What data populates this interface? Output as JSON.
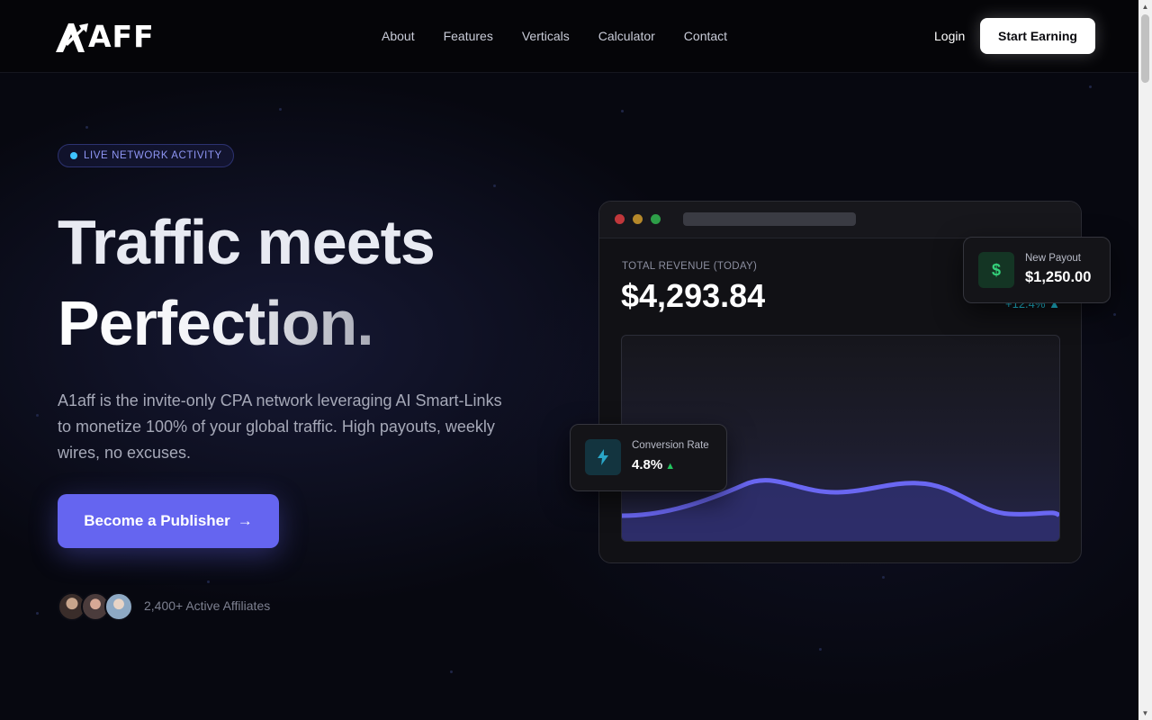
{
  "brand": {
    "name": "A1AFF",
    "logo_text": "AFF"
  },
  "nav": {
    "items": [
      "About",
      "Features",
      "Verticals",
      "Calculator",
      "Contact"
    ],
    "login_label": "Login",
    "start_label": "Start Earning"
  },
  "hero": {
    "badge": "LIVE NETWORK ACTIVITY",
    "headline_line1": "Traffic meets",
    "headline_line2": "Perfection.",
    "description": "A1aff is the invite-only CPA network leveraging AI Smart-Links to monetize 100% of your global traffic. High payouts, weekly wires, no excuses.",
    "cta_label": "Become a Publisher",
    "cta_arrow": "→",
    "affiliates_text": "2,400+ Active Affiliates"
  },
  "dashboard": {
    "revenue_label": "TOTAL REVENUE (TODAY)",
    "revenue_value": "$4,293.84",
    "revenue_change": "+12.4% ▲",
    "payout_icon": "$",
    "payout_label": "New Payout",
    "payout_value": "$1,250.00",
    "conversion_label": "Conversion Rate",
    "conversion_value": "4.8%",
    "conversion_trend": "▲"
  },
  "colors": {
    "accent": "#6565f0",
    "chart_line": "#6a67f2",
    "positive": "#22c55e",
    "cyan": "#22d3ee"
  },
  "icons": [
    "logo-icon",
    "arrow-right-icon",
    "dollar-icon",
    "lightning-icon",
    "scroll-up-icon",
    "scroll-down-icon"
  ]
}
